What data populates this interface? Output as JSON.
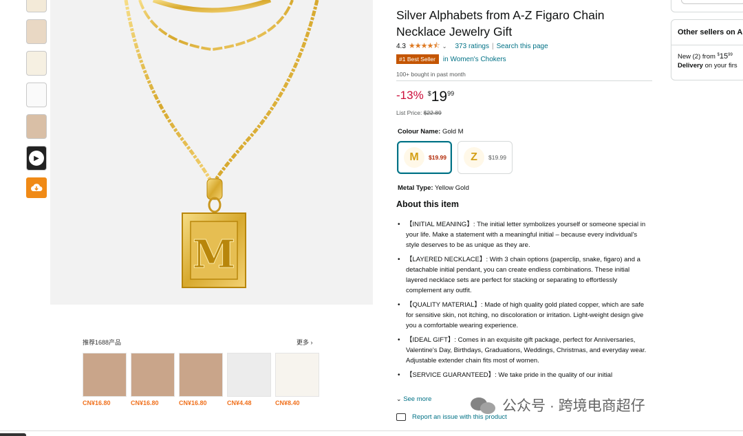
{
  "product": {
    "title": "Silver Alphabets from A-Z Figaro Chain Necklace Jewelry Gift",
    "rating_value": "4.3",
    "stars": "★★★★⯪",
    "ratings_link": "373 ratings",
    "search_page_link": "Search this page",
    "best_seller_badge": "#1 Best Seller",
    "best_seller_category": "in Women's Chokers",
    "bought_text": "100+ bought in past month",
    "discount": "-13%",
    "price_symbol": "$",
    "price_whole": "19",
    "price_fraction": "99",
    "list_price_label": "List Price:",
    "list_price": "$22.89",
    "colour_label": "Colour Name:",
    "colour_value": "Gold M",
    "swatches": [
      {
        "letter": "M",
        "price": "$19.99"
      },
      {
        "letter": "Z",
        "price": "$19.99"
      }
    ],
    "metal_label": "Metal Type:",
    "metal_value": "Yellow Gold",
    "about_heading": "About this item",
    "bullets": [
      "【INITIAL MEANING】: The initial letter symbolizes yourself or someone special in your life. Make a statement with a meaningful initial – because every individual's style deserves to be as unique as they are.",
      "【LAYERED NECKLACE】: With 3 chain options (paperclip, snake, figaro) and a detachable initial pendant, you can create endless combinations. These initial layered necklace sets are perfect for stacking or separating to effortlessly complement any outfit.",
      "【QUALITY MATERIAL】: Made of high quality gold plated copper, which are safe for sensitive skin, not itching, no discoloration or irritation. Light-weight design give you a comfortable wearing experience.",
      "【IDEAL GIFT】: Comes in an exquisite gift package, perfect for Anniversaries, Valentine's Day, Birthdays, Graduations, Weddings, Christmas, and everyday wear. Adjustable extender chain fits most of women.",
      "【SERVICE GUARANTEED】: We take pride in the quality of our initial"
    ],
    "see_more": "See more",
    "report_link": "Report an issue with this product"
  },
  "pendant_letter": "M",
  "recommend": {
    "title": "推荐1688产品",
    "more": "更多 ›",
    "items": [
      {
        "price": "CN¥16.80"
      },
      {
        "price": "CN¥16.80"
      },
      {
        "price": "CN¥16.80"
      },
      {
        "price": "CN¥4.48"
      },
      {
        "price": "CN¥8.40"
      }
    ]
  },
  "other_sellers": {
    "heading": "Other sellers on A",
    "new_text": "New (2) from ",
    "new_symbol": "$",
    "new_whole": "15",
    "new_fraction": "99",
    "delivery_bold": "Delivery",
    "delivery_text": " on your firs"
  },
  "watermark": "公众号 · 跨境电商超仔",
  "colors": {
    "accent": "#007185",
    "badge": "#c45500",
    "discount": "#cc0c39",
    "orange": "#f08a16"
  }
}
